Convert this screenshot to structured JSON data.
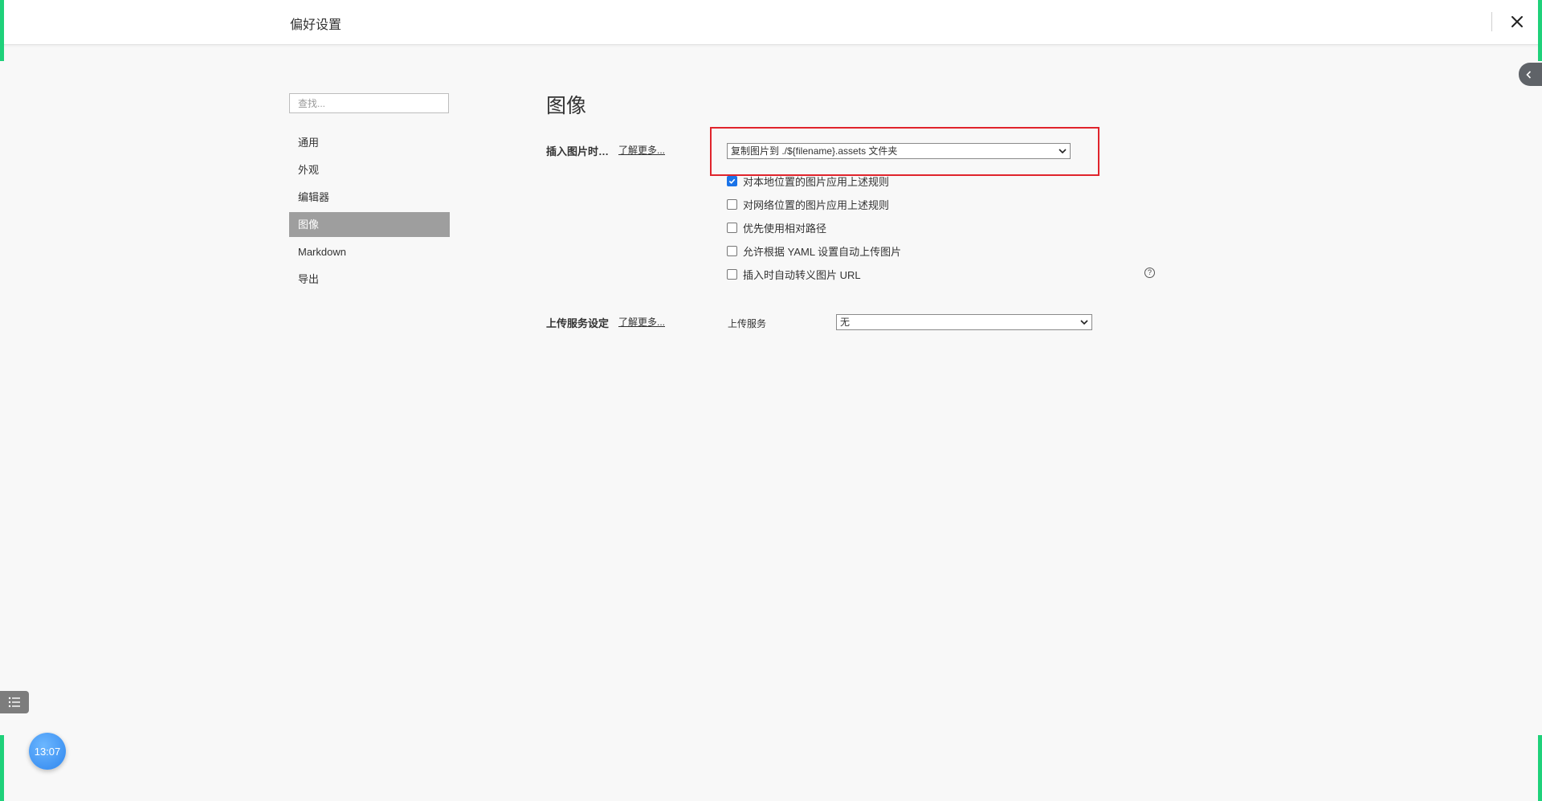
{
  "window": {
    "title": "偏好设置",
    "close_icon": "close-icon"
  },
  "sidebar": {
    "search_placeholder": "查找...",
    "items": [
      {
        "label": "通用",
        "active": false
      },
      {
        "label": "外观",
        "active": false
      },
      {
        "label": "编辑器",
        "active": false
      },
      {
        "label": "图像",
        "active": true
      },
      {
        "label": "Markdown",
        "active": false
      },
      {
        "label": "导出",
        "active": false
      }
    ]
  },
  "main": {
    "title": "图像",
    "insert_section": {
      "label": "插入图片时…",
      "learn_more": "了解更多...",
      "select_value": "复制图片到 ./${filename}.assets 文件夹",
      "options": [
        {
          "label": "对本地位置的图片应用上述规则",
          "checked": true
        },
        {
          "label": "对网络位置的图片应用上述规则",
          "checked": false
        },
        {
          "label": "优先使用相对路径",
          "checked": false
        },
        {
          "label": "允许根据 YAML 设置自动上传图片",
          "checked": false
        },
        {
          "label": "插入时自动转义图片 URL",
          "checked": false
        }
      ],
      "help_icon": "?"
    },
    "upload_section": {
      "label": "上传服务设定",
      "learn_more": "了解更多...",
      "service_label": "上传服务",
      "service_value": "无"
    }
  },
  "overlay": {
    "clock_time": "13:07"
  },
  "colors": {
    "accent_green": "#1fd17a",
    "highlight_red": "#e0242c",
    "active_nav": "#9e9e9e",
    "checkbox_blue": "#1a73e8"
  }
}
